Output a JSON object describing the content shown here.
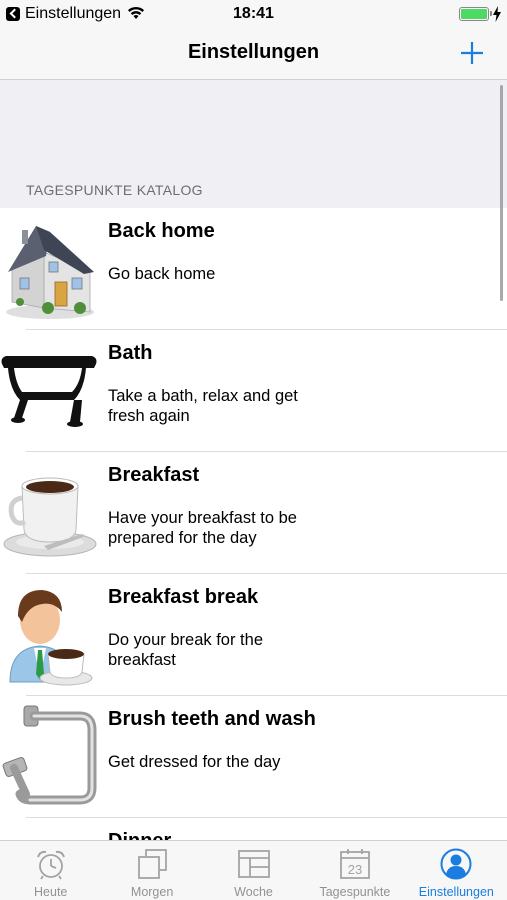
{
  "status_bar": {
    "back_app": "Einstellungen",
    "time": "18:41",
    "battery_level": 1.0
  },
  "nav": {
    "title": "Einstellungen",
    "add_icon": "plus-icon"
  },
  "section": {
    "header": "TAGESPUNKTE KATALOG"
  },
  "items": [
    {
      "title": "Back home",
      "description": "Go back home",
      "icon": "house-icon"
    },
    {
      "title": "Bath",
      "description": "Take a bath, relax and get fresh again",
      "icon": "bathtub-icon"
    },
    {
      "title": "Breakfast",
      "description": "Have your breakfast to be prepared for the day",
      "icon": "coffee-cup-icon"
    },
    {
      "title": "Breakfast break",
      "description": "Do your break for the breakfast",
      "icon": "person-coffee-icon"
    },
    {
      "title": "Brush teeth and wash",
      "description": "Get dressed for the day",
      "icon": "towel-holder-icon"
    },
    {
      "title": "Dinner",
      "description": "",
      "icon": ""
    }
  ],
  "tabs": [
    {
      "label": "Heute",
      "icon": "alarm-clock-icon",
      "active": false
    },
    {
      "label": "Morgen",
      "icon": "stacked-squares-icon",
      "active": false
    },
    {
      "label": "Woche",
      "icon": "grid-layout-icon",
      "active": false
    },
    {
      "label": "Tagespunkte",
      "icon": "calendar-icon",
      "active": false,
      "calendar_day": "23"
    },
    {
      "label": "Einstellungen",
      "icon": "person-icon",
      "active": true
    }
  ],
  "colors": {
    "accent": "#1a7de0",
    "inactive": "#929292",
    "battery": "#4cd964",
    "group_background": "#efeff4"
  }
}
